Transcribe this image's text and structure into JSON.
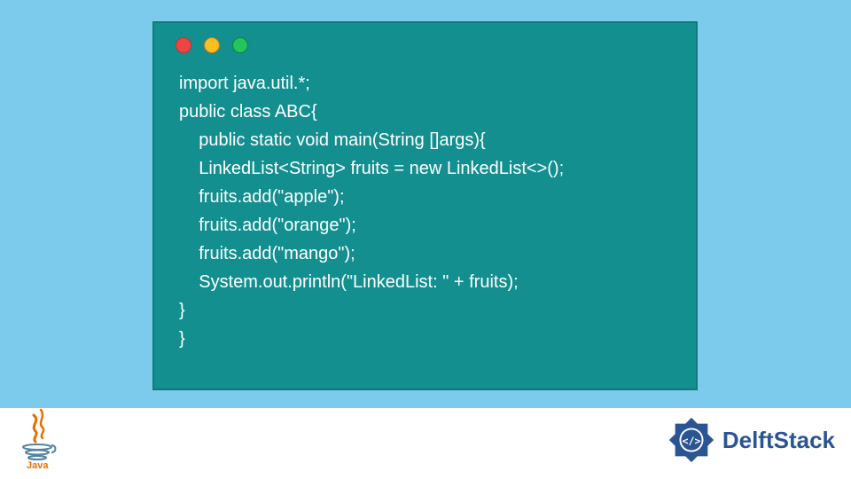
{
  "code": {
    "lines": [
      "import java.util.*;",
      "public class ABC{",
      "    public static void main(String []args){",
      "    LinkedList<String> fruits = new LinkedList<>();",
      "    fruits.add(\"apple\");",
      "    fruits.add(\"orange\");",
      "    fruits.add(\"mango\");",
      "    System.out.println(\"LinkedList: \" + fruits);",
      "}",
      "}"
    ]
  },
  "logos": {
    "java_label": "Java",
    "delft_label": "DelftStack"
  }
}
